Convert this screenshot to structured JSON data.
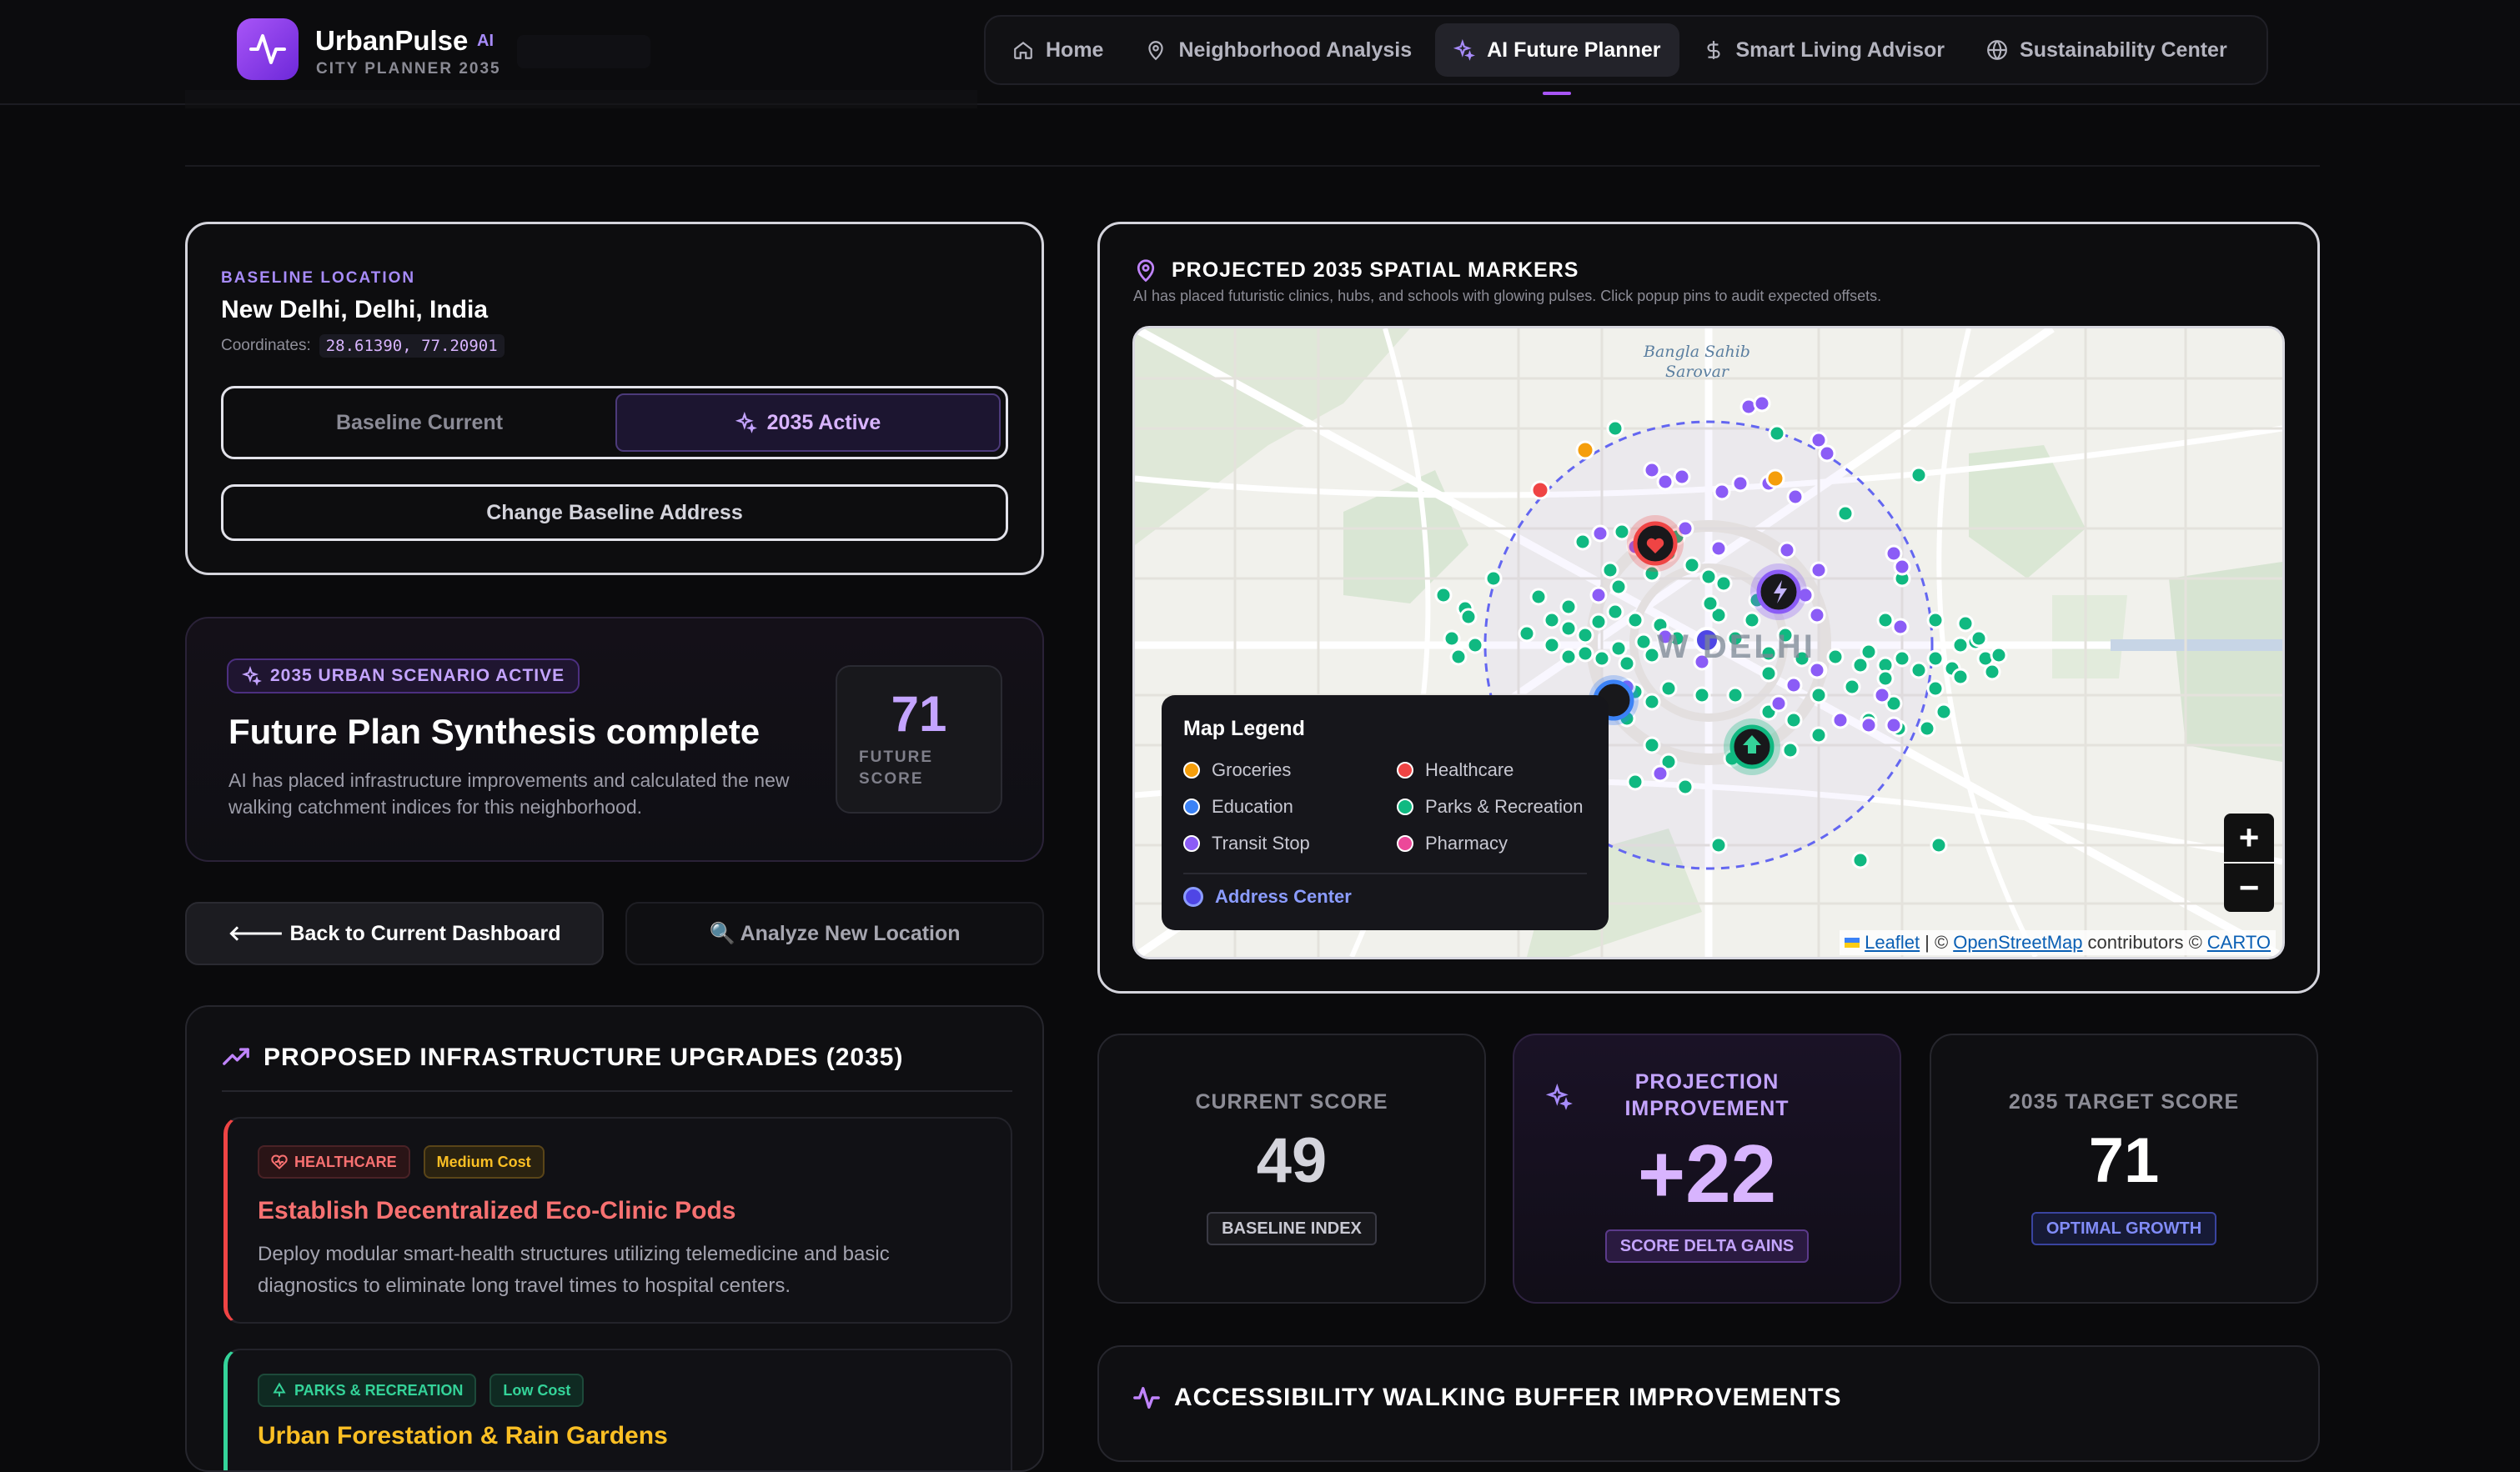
{
  "app": {
    "name": "UrbanPulse",
    "badge": "AI",
    "subtitle": "CITY PLANNER 2035"
  },
  "nav": [
    {
      "label": "Home",
      "icon": "home-icon"
    },
    {
      "label": "Neighborhood Analysis",
      "icon": "map-pin-icon"
    },
    {
      "label": "AI Future Planner",
      "icon": "sparkles-icon",
      "active": true
    },
    {
      "label": "Smart Living Advisor",
      "icon": "dollar-icon"
    },
    {
      "label": "Sustainability Center",
      "icon": "globe-icon"
    }
  ],
  "location": {
    "eyebrow": "BASELINE LOCATION",
    "name": "New Delhi, Delhi, India",
    "coord_label": "Coordinates:",
    "coords": "28.61390, 77.20901",
    "toggle_off": "Baseline Current",
    "toggle_on": "2035 Active",
    "change_btn": "Change Baseline Address"
  },
  "scenario": {
    "pill": "2035 URBAN SCENARIO ACTIVE",
    "title": "Future Plan Synthesis complete",
    "desc": "AI has placed infrastructure improvements and calculated the new walking catchment indices for this neighborhood.",
    "score": "71",
    "score_label": "FUTURE SCORE"
  },
  "actions": {
    "back": "🡐 Back to Current Dashboard",
    "analyze": "🔍 Analyze New Location"
  },
  "upgrades": {
    "title": "PROPOSED INFRASTRUCTURE UPGRADES (2035)",
    "items": [
      {
        "category": "HEALTHCARE",
        "cost": "Medium Cost",
        "title": "Establish Decentralized Eco-Clinic Pods",
        "desc": "Deploy modular smart-health structures utilizing telemedicine and basic diagnostics to eliminate long travel times to hospital centers.",
        "color": "#ef4444"
      },
      {
        "category": "PARKS & RECREATION",
        "cost": "Low Cost",
        "title": "Urban Forestation & Rain Gardens",
        "desc": "",
        "color": "#34d399"
      }
    ]
  },
  "map": {
    "title": "PROJECTED 2035 SPATIAL MARKERS",
    "subtitle": "AI has placed futuristic clinics, hubs, and schools with glowing pulses. Click popup pins to audit expected offsets.",
    "place_label_1": "Bangla Sahib",
    "place_label_2": "Sarovar",
    "city_label": "W DELHI",
    "legend_title": "Map Legend",
    "legend": [
      {
        "label": "Groceries",
        "color": "#f59e0b"
      },
      {
        "label": "Healthcare",
        "color": "#ef4444"
      },
      {
        "label": "Education",
        "color": "#3b82f6"
      },
      {
        "label": "Parks & Recreation",
        "color": "#10b981"
      },
      {
        "label": "Transit Stop",
        "color": "#8b5cf6"
      },
      {
        "label": "Pharmacy",
        "color": "#ec4899"
      }
    ],
    "address_center": "Address Center",
    "zoom_in": "+",
    "zoom_out": "−",
    "attr_leaflet": "Leaflet",
    "attr_sep": "| ©",
    "attr_osm": "OpenStreetMap",
    "attr_mid": "contributors ©",
    "attr_carto": "CARTO"
  },
  "stats": {
    "current_label": "CURRENT SCORE",
    "current_value": "49",
    "current_badge": "BASELINE INDEX",
    "proj_label": "PROJECTION IMPROVEMENT",
    "proj_value": "+22",
    "proj_badge": "SCORE DELTA GAINS",
    "target_label": "2035 TARGET SCORE",
    "target_value": "71",
    "target_badge": "OPTIMAL GROWTH"
  },
  "walking": {
    "title": "ACCESSIBILITY WALKING BUFFER IMPROVEMENTS"
  }
}
